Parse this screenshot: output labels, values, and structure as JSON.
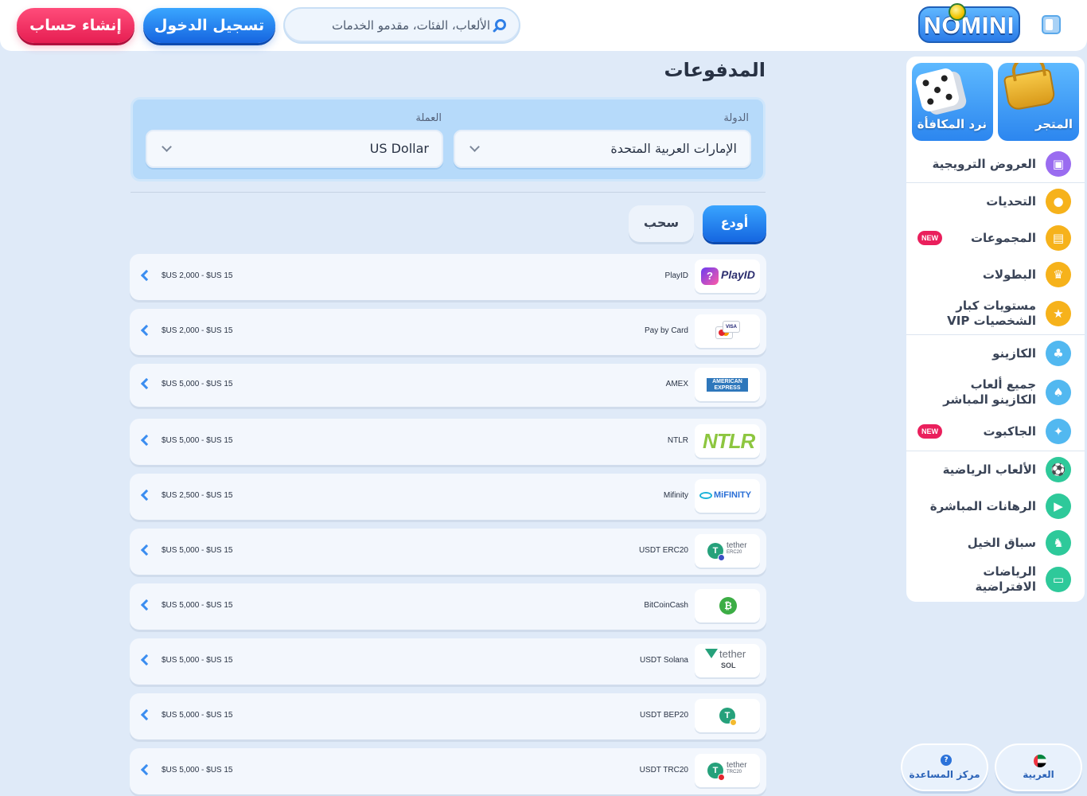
{
  "header": {
    "logo_text": "NOMINI",
    "search_placeholder": "الألعاب، الفئات، مقدمو الخدمات",
    "login_label": "تسجيل الدخول",
    "register_label": "إنشاء حساب"
  },
  "sidebar": {
    "tiles": [
      {
        "label": "المتجر",
        "icon": "basket-icon"
      },
      {
        "label": "نرد المكافأة",
        "icon": "dice-icon"
      }
    ],
    "items": [
      {
        "label": "العروض الترويجية",
        "icon": "gift-icon",
        "color": "#9a6cf0"
      },
      {
        "label": "التحديات",
        "icon": "badge-icon",
        "color": "#f6b21b"
      },
      {
        "label": "المجموعات",
        "icon": "cards-icon",
        "color": "#f6b21b",
        "badge": "NEW"
      },
      {
        "label": "البطولات",
        "icon": "trophy-icon",
        "color": "#f6b21b"
      },
      {
        "label": "مستويات كبار الشخصيات VIP",
        "icon": "crown-icon",
        "color": "#f6b21b"
      },
      {
        "label": "الكازينو",
        "icon": "casino-icon",
        "color": "#52b8f0"
      },
      {
        "label": "جميع ألعاب الكازينو المباشر",
        "icon": "live-casino-icon",
        "color": "#52b8f0"
      },
      {
        "label": "الجاكبوت",
        "icon": "jackpot-icon",
        "color": "#52b8f0",
        "badge": "NEW"
      },
      {
        "label": "الألعاب الرياضية",
        "icon": "soccer-icon",
        "color": "#2ec99a"
      },
      {
        "label": "الرهانات المباشرة",
        "icon": "live-bets-icon",
        "color": "#2ec99a"
      },
      {
        "label": "سباق الخيل",
        "icon": "horse-icon",
        "color": "#2ec99a"
      },
      {
        "label": "الرياضات الافتراضية",
        "icon": "virtual-sports-icon",
        "color": "#2ec99a"
      }
    ]
  },
  "main": {
    "title": "المدفوعات",
    "country_label": "الدولة",
    "country_value": "الإمارات العربية المتحدة",
    "currency_label": "العملة",
    "currency_value": "US Dollar",
    "tabs": {
      "deposit": "أودع",
      "withdraw": "سحب"
    },
    "methods": [
      {
        "name": "PlayID",
        "limits": "$US 2,000 - $US 15"
      },
      {
        "name": "Pay by Card",
        "limits": "$US 2,000 - $US 15"
      },
      {
        "name": "AMEX",
        "limits": "$US 5,000 - $US 15"
      },
      {
        "name": "NTLR",
        "limits": "$US 5,000 - $US 15"
      },
      {
        "name": "Mifinity",
        "limits": "$US 2,500 - $US 15"
      },
      {
        "name": "USDT ERC20",
        "limits": "$US 5,000 - $US 15"
      },
      {
        "name": "BitCoinCash",
        "limits": "$US 5,000 - $US 15"
      },
      {
        "name": "USDT Solana",
        "limits": "$US 5,000 - $US 15"
      },
      {
        "name": "USDT BEP20",
        "limits": "$US 5,000 - $US 15"
      },
      {
        "name": "USDT TRC20",
        "limits": "$US 5,000 - $US 15"
      }
    ],
    "logos": {
      "playid": "PlayID",
      "visa": "VISA",
      "amex": "AMERICAN EXPRESS",
      "ntlr": "NTLR",
      "mifinity": "MiFINITY",
      "tether": "tether",
      "erc20": "ERC20",
      "sol": "SOL",
      "trc20": "TRC20"
    }
  },
  "footer": {
    "language_label": "العربية",
    "help_label": "مركز المساعدة"
  }
}
